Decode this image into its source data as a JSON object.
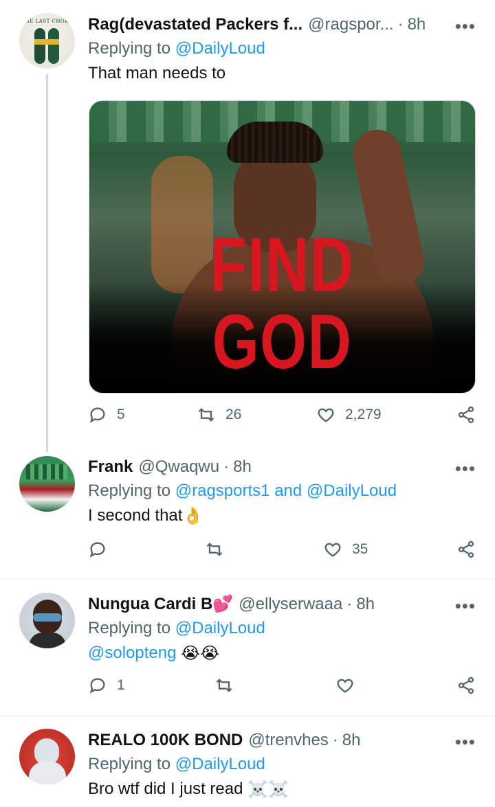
{
  "tweets": [
    {
      "name": "Rag(devastated Packers f...",
      "handle": "@ragspor...",
      "time": "8h",
      "reply_prefix": "Replying to",
      "reply_to": "@DailyLoud",
      "reply_and": "",
      "reply_to_2": "",
      "text": "That man needs to",
      "avatar_text": "THE LAST CHOKE",
      "media_caption": "FIND GOD",
      "replies": "5",
      "retweets": "26",
      "likes": "2,279"
    },
    {
      "name": "Frank",
      "handle": "@Qwaqwu",
      "time": "8h",
      "reply_prefix": "Replying to",
      "reply_to": "@ragsports1",
      "reply_and": "and",
      "reply_to_2": "@DailyLoud",
      "text": "I second that",
      "text_emoji": "👌",
      "replies": "",
      "retweets": "",
      "likes": "35"
    },
    {
      "name": "Nungua Cardi B",
      "name_emoji": "💕",
      "handle": "@ellyserwaaa",
      "time": "8h",
      "reply_prefix": "Replying to",
      "reply_to": "@DailyLoud",
      "text_mention": "@solopteng",
      "text_emoji": "😭😭",
      "replies": "1",
      "retweets": "",
      "likes": ""
    },
    {
      "name": "REALO 100K BOND",
      "handle": "@trenvhes",
      "time": "8h",
      "reply_prefix": "Replying to",
      "reply_to": "@DailyLoud",
      "text": "Bro wtf did I just read",
      "text_emoji": "☠️☠️"
    }
  ],
  "dot": "·",
  "more": "•••",
  "colors": {
    "link": "#1d9bf0",
    "muted": "#536471",
    "text": "#0f1419",
    "caption": "#d7171f"
  }
}
